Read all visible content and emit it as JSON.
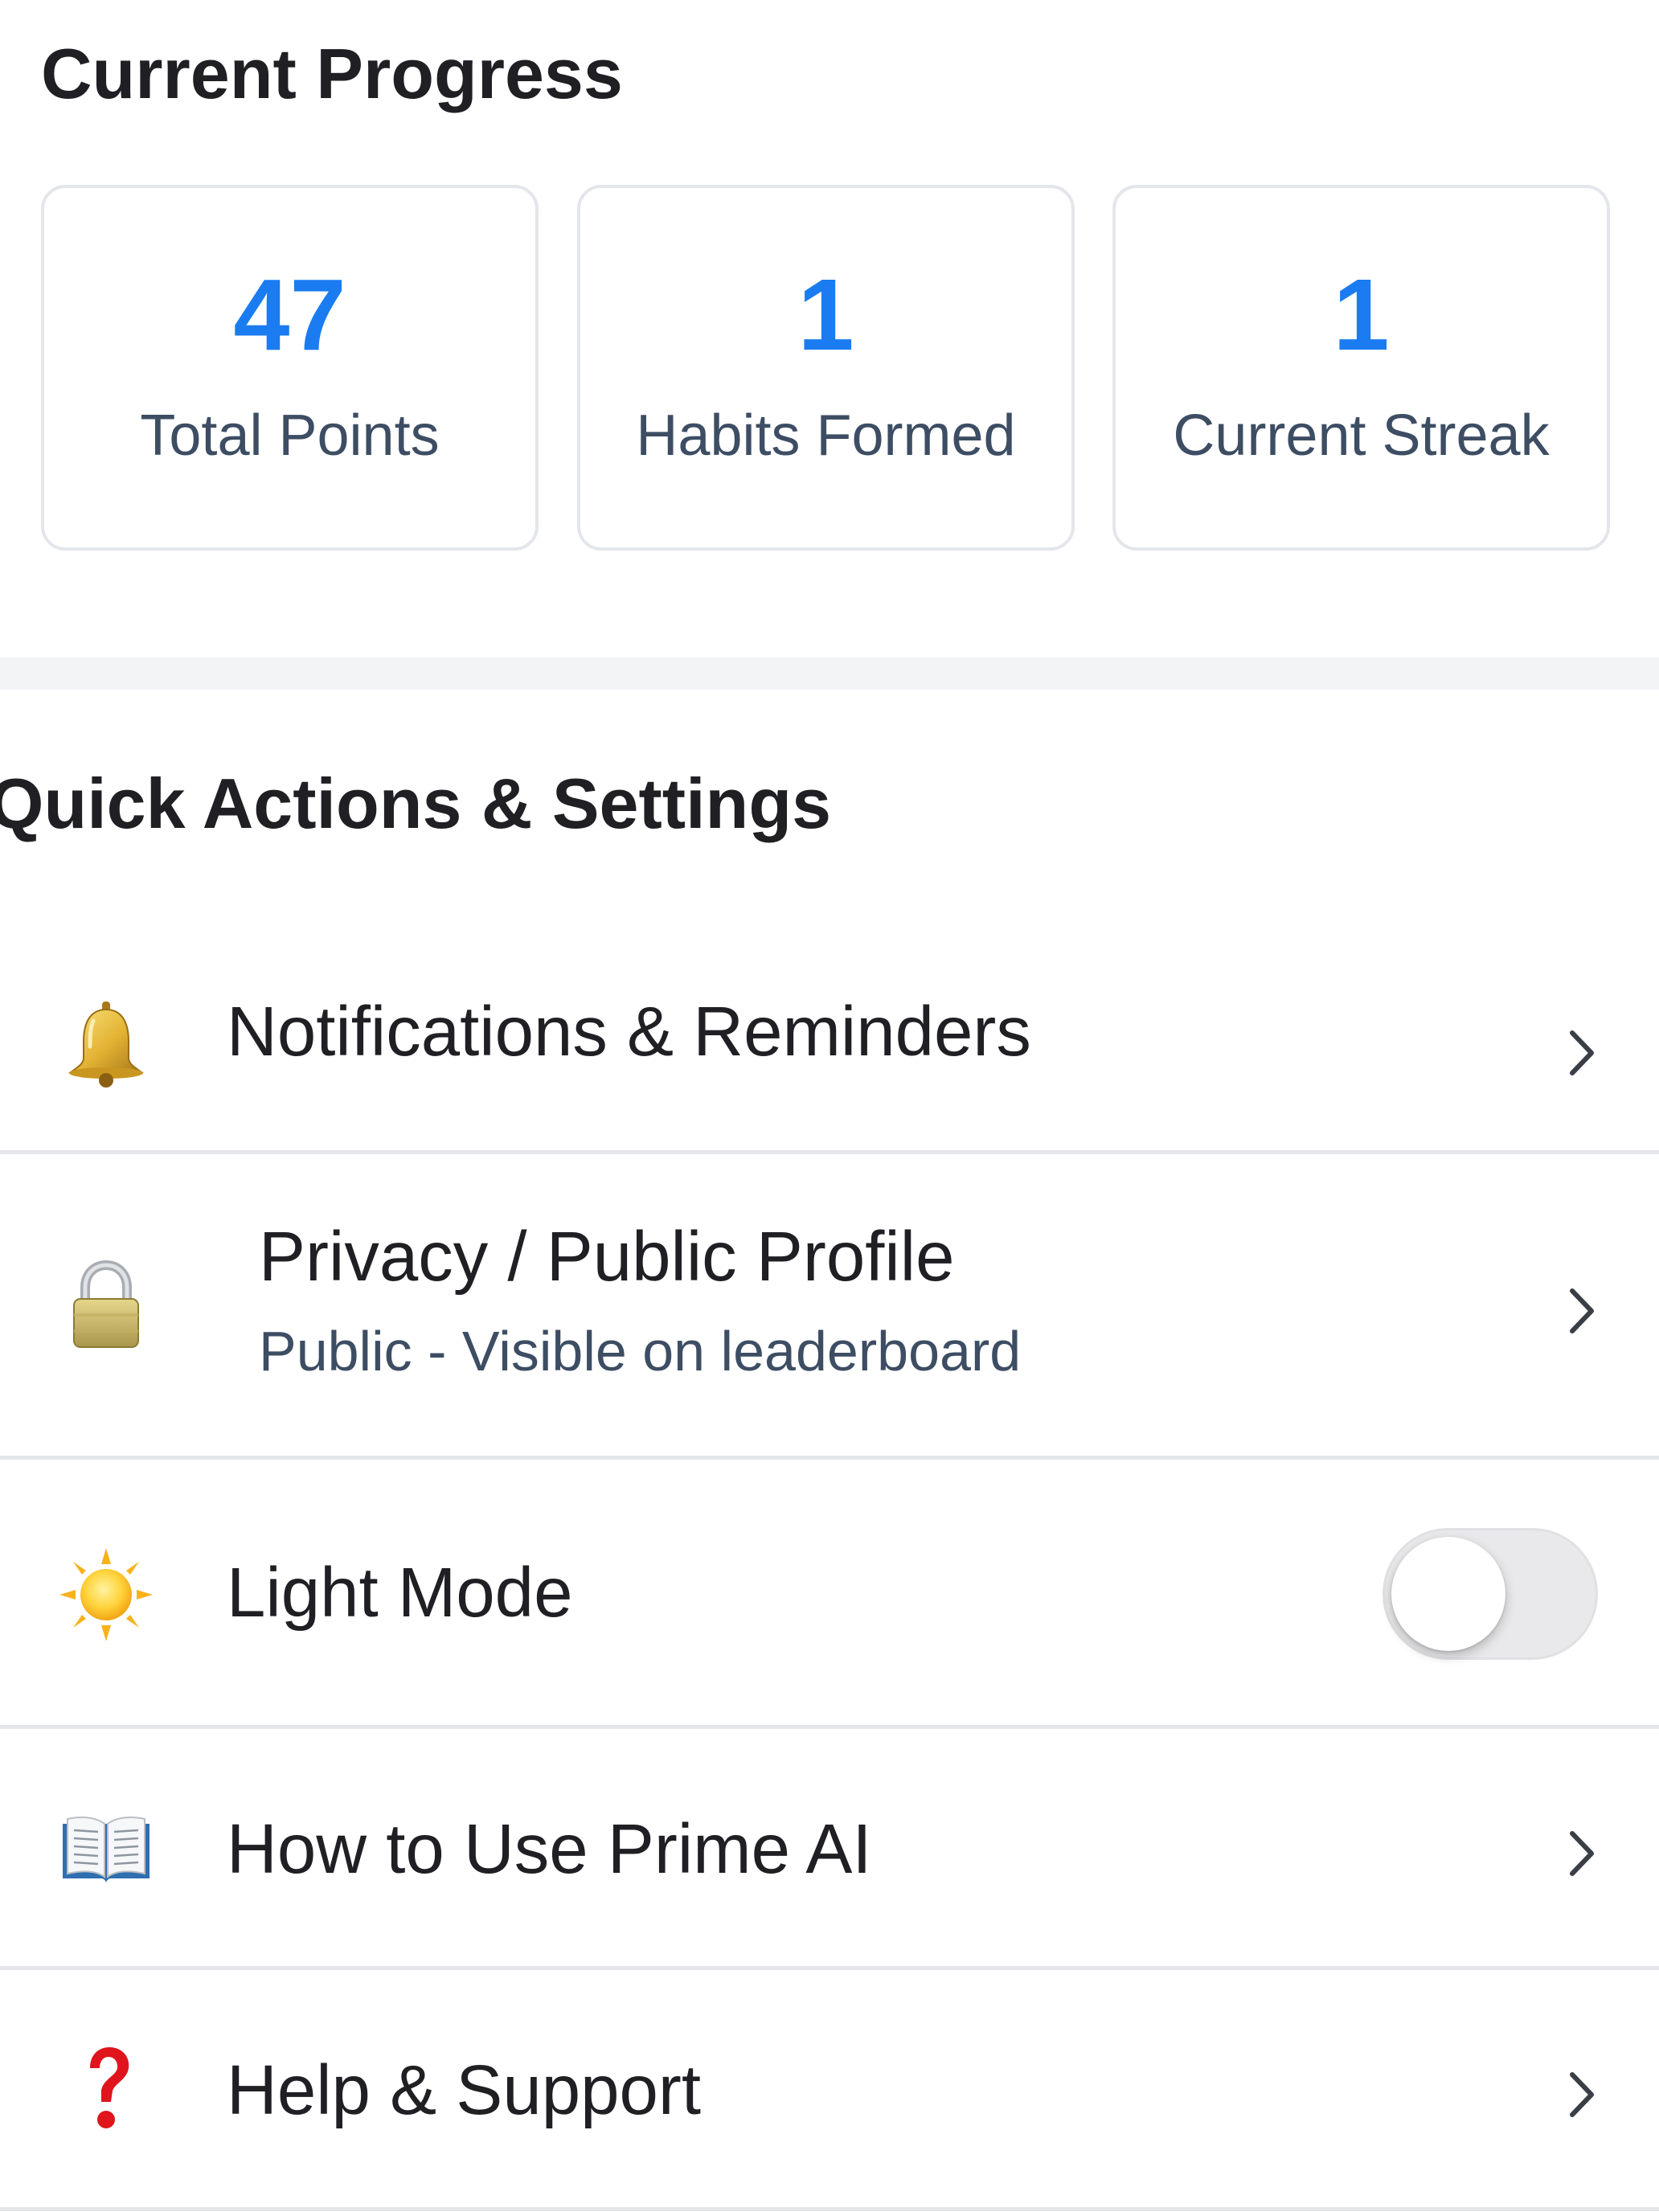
{
  "progress": {
    "title": "Current Progress",
    "stats": [
      {
        "value": "47",
        "label": "Total Points"
      },
      {
        "value": "1",
        "label": "Habits Formed"
      },
      {
        "value": "1",
        "label": "Current Streak"
      }
    ],
    "value_color": "#1a7cf0"
  },
  "quick_actions": {
    "title": "Quick Actions & Settings",
    "items": [
      {
        "icon": "bell-icon",
        "label": "Notifications & Reminders",
        "trailing": "chevron-right-icon"
      },
      {
        "icon": "lock-icon",
        "label": "Privacy / Public Profile",
        "subtitle": "Public - Visible on leaderboard",
        "trailing": "chevron-right-icon"
      },
      {
        "icon": "sun-icon",
        "label": "Light Mode",
        "trailing": "toggle",
        "toggle_on": false
      },
      {
        "icon": "open-book-icon",
        "label": "How to Use Prime AI",
        "trailing": "chevron-right-icon"
      },
      {
        "icon": "question-mark-icon",
        "label": "Help & Support",
        "trailing": "chevron-right-icon"
      }
    ]
  }
}
